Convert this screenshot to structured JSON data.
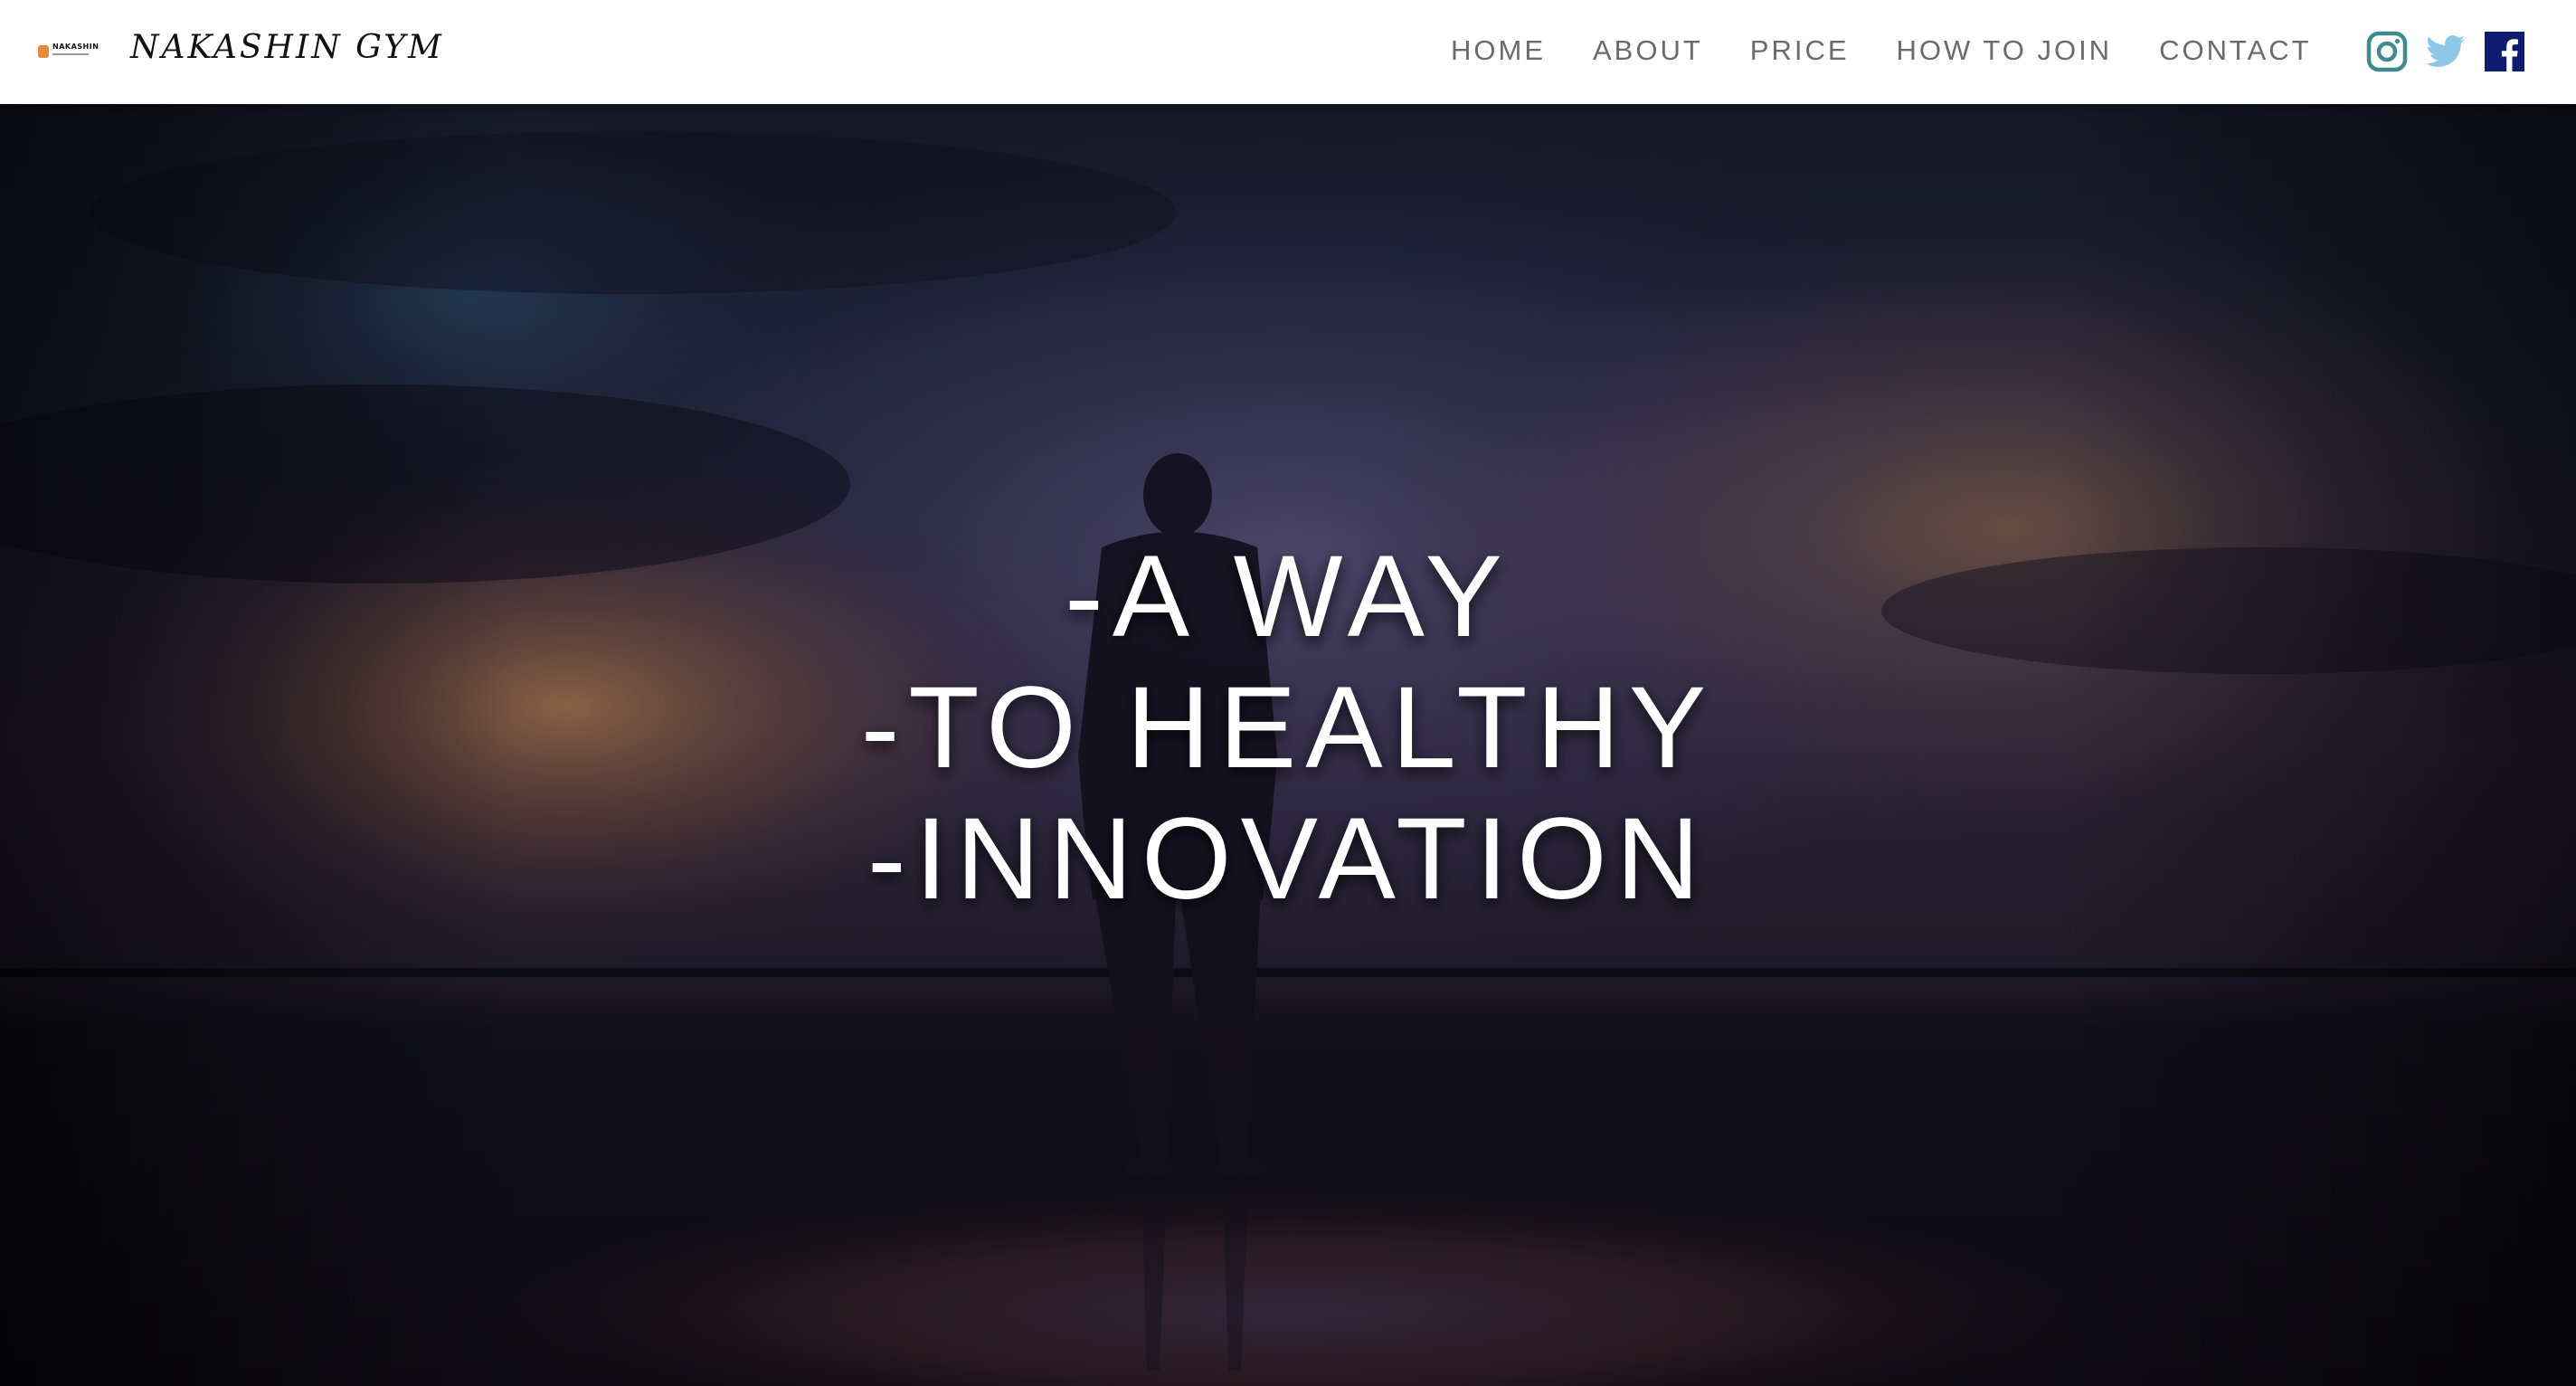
{
  "header": {
    "logo_text": "NAKASHIN",
    "brand_name": "NAKASHIN GYM",
    "nav": [
      {
        "label": "HOME"
      },
      {
        "label": "ABOUT"
      },
      {
        "label": "PRICE"
      },
      {
        "label": "HOW TO JOIN"
      },
      {
        "label": "CONTACT"
      }
    ],
    "social": [
      {
        "name": "instagram-icon",
        "color": "#3f8a8f"
      },
      {
        "name": "twitter-icon",
        "color": "#8ec8e8"
      },
      {
        "name": "facebook-icon",
        "color": "#0f1b6e"
      }
    ]
  },
  "hero": {
    "lines": [
      "-A WAY",
      "-TO HEALTHY",
      "-INNOVATION"
    ],
    "text_color": "#ffffff"
  }
}
